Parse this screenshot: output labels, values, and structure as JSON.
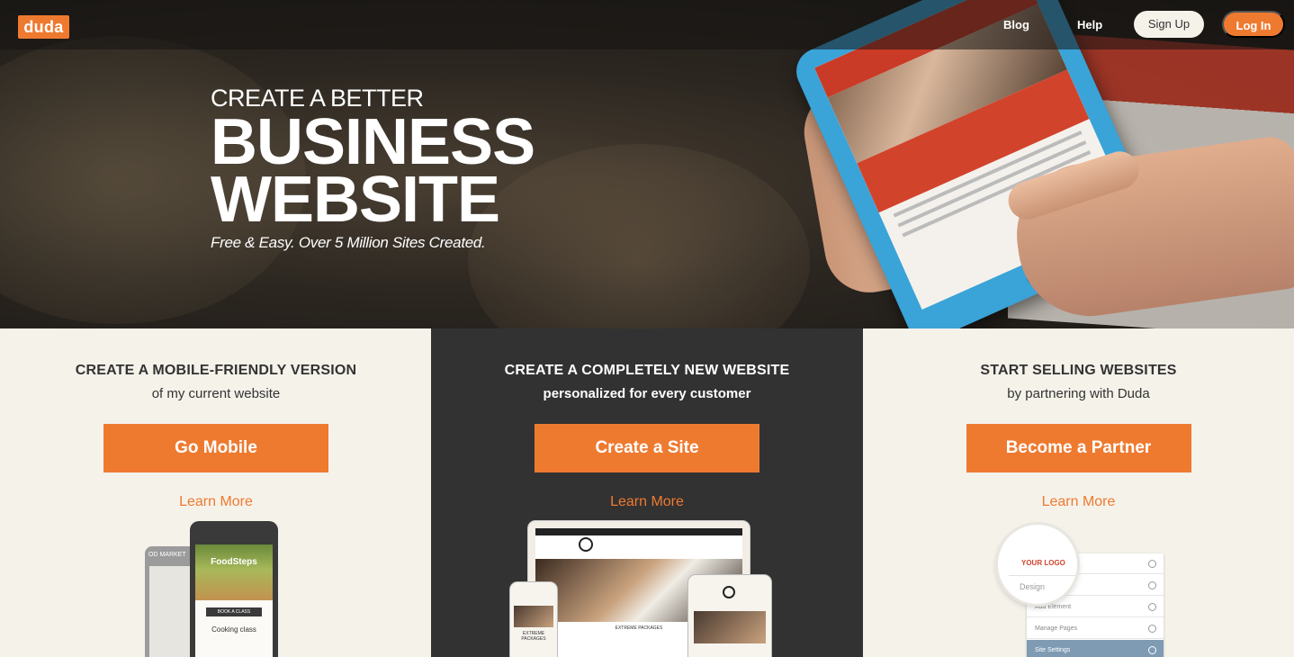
{
  "header": {
    "logo": "duda",
    "nav": {
      "blog": "Blog",
      "help": "Help"
    },
    "signup": "Sign Up",
    "login": "Log In"
  },
  "hero": {
    "pre_title": "CREATE A BETTER",
    "title_line1": "BUSINESS",
    "title_line2": "WEBSITE",
    "subtitle": "Free & Easy. Over 5 Million Sites Created."
  },
  "columns": [
    {
      "title": "CREATE A MOBILE-FRIENDLY VERSION",
      "subtitle": "of my current website",
      "cta": "Go Mobile",
      "learn": "Learn More",
      "illustration": {
        "back_phone_text": "OD MARKET",
        "brand": "FoodSteps",
        "button": "BOOK A CLASS",
        "caption": "Cooking class"
      }
    },
    {
      "title": "CREATE A COMPLETELY NEW WEBSITE",
      "subtitle": "personalized for every customer",
      "cta": "Create a Site",
      "learn": "Learn More",
      "illustration": {
        "caption": "EXTREME PACKAGES"
      }
    },
    {
      "title": "START SELLING WEBSITES",
      "subtitle": "by partnering with Duda",
      "cta": "Become a Partner",
      "learn": "Learn More",
      "illustration": {
        "logo": "YOUR LOGO",
        "design": "Design",
        "add_element": "Add Element",
        "manage_pages": "Manage Pages",
        "site_settings": "Site Settings"
      }
    }
  ],
  "colors": {
    "accent": "#ee7a30",
    "dark_column": "#333232",
    "light_column": "#f5f2ea"
  }
}
